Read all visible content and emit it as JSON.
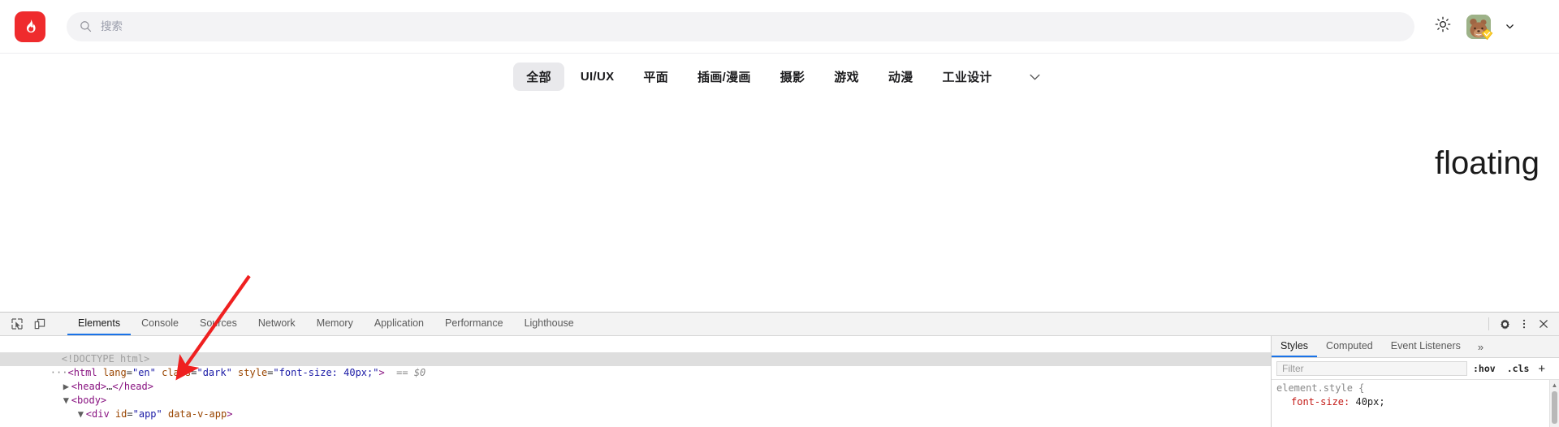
{
  "page": {
    "header": {
      "logo_icon": "flame-icon",
      "search": {
        "icon": "search-icon",
        "placeholder": "搜索",
        "value": ""
      },
      "theme_toggle_icon": "sun-icon",
      "avatar_icon": "bear-avatar",
      "avatar_badge_icon": "diamond-badge-icon",
      "account_chevron_icon": "chevron-down-icon"
    },
    "categories": {
      "items": [
        {
          "label": "全部",
          "active": true
        },
        {
          "label": "UI/UX",
          "active": false
        },
        {
          "label": "平面",
          "active": false
        },
        {
          "label": "插画/漫画",
          "active": false
        },
        {
          "label": "摄影",
          "active": false
        },
        {
          "label": "游戏",
          "active": false
        },
        {
          "label": "动漫",
          "active": false
        },
        {
          "label": "工业设计",
          "active": false
        }
      ],
      "expand_icon": "chevron-down-icon"
    },
    "content": {
      "floating_text": "floating"
    },
    "annotation": {
      "arrow_color": "#ef2020"
    }
  },
  "devtools": {
    "toolbar": {
      "inspect_icon": "inspect-element-icon",
      "device_icon": "device-toolbar-icon",
      "tabs": [
        {
          "label": "Elements",
          "active": true
        },
        {
          "label": "Console",
          "active": false
        },
        {
          "label": "Sources",
          "active": false
        },
        {
          "label": "Network",
          "active": false
        },
        {
          "label": "Memory",
          "active": false
        },
        {
          "label": "Application",
          "active": false
        },
        {
          "label": "Performance",
          "active": false
        },
        {
          "label": "Lighthouse",
          "active": false
        }
      ],
      "settings_icon": "gear-icon",
      "more_icon": "kebab-menu-icon",
      "close_icon": "close-icon"
    },
    "dom": {
      "lines": [
        {
          "indent": 1,
          "selected": false,
          "parts": [
            {
              "t": "doctype",
              "s": "<!DOCTYPE html>"
            }
          ]
        },
        {
          "indent": 0,
          "selected": true,
          "parts": [
            {
              "t": "ellip",
              "s": "···"
            },
            {
              "t": "tag",
              "s": "<html"
            },
            {
              "t": "attr",
              "s": " lang"
            },
            {
              "t": "punc",
              "s": "="
            },
            {
              "t": "val",
              "s": "\"en\""
            },
            {
              "t": "attr",
              "s": " class"
            },
            {
              "t": "punc",
              "s": "="
            },
            {
              "t": "val",
              "s": "\"dark\""
            },
            {
              "t": "attr",
              "s": " style"
            },
            {
              "t": "punc",
              "s": "="
            },
            {
              "t": "val",
              "s": "\"font-size: 40px;\""
            },
            {
              "t": "tag",
              "s": ">"
            },
            {
              "t": "dollar",
              "s": "  == $0"
            }
          ]
        },
        {
          "indent": 1,
          "selected": false,
          "parts": [
            {
              "t": "arrow",
              "s": "▶"
            },
            {
              "t": "tag",
              "s": "<head>"
            },
            {
              "t": "punc",
              "s": "…"
            },
            {
              "t": "tag",
              "s": "</head>"
            }
          ]
        },
        {
          "indent": 1,
          "selected": false,
          "parts": [
            {
              "t": "arrow",
              "s": "▼"
            },
            {
              "t": "tag",
              "s": "<body>"
            }
          ]
        },
        {
          "indent": 2,
          "selected": false,
          "parts": [
            {
              "t": "arrow",
              "s": "▼"
            },
            {
              "t": "tag",
              "s": "<div"
            },
            {
              "t": "attr",
              "s": " id"
            },
            {
              "t": "punc",
              "s": "="
            },
            {
              "t": "val",
              "s": "\"app\""
            },
            {
              "t": "attr",
              "s": " data-v-app"
            },
            {
              "t": "tag",
              "s": ">"
            }
          ]
        }
      ]
    },
    "styles": {
      "tabs": [
        {
          "label": "Styles",
          "active": true
        },
        {
          "label": "Computed",
          "active": false
        },
        {
          "label": "Event Listeners",
          "active": false
        }
      ],
      "overflow_label": "»",
      "filter": {
        "placeholder": "Filter",
        "value": ""
      },
      "hov_label": ":hov",
      "cls_label": ".cls",
      "plus_label": "+",
      "rules": [
        {
          "selector": "element.style {",
          "declarations": [
            {
              "prop": "font-size:",
              "value": " 40px;"
            }
          ]
        }
      ]
    }
  }
}
